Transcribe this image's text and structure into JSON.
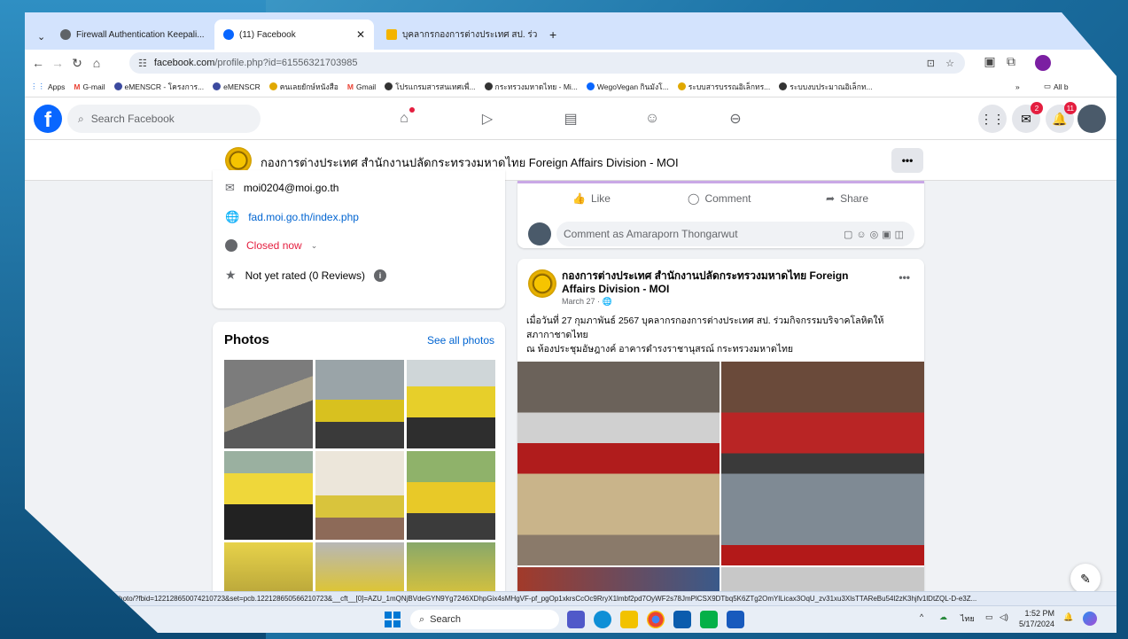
{
  "browser": {
    "tabs": [
      {
        "label": "Firewall Authentication Keepali...",
        "active": false,
        "favicon_color": "#5f6368"
      },
      {
        "label": "(11) Facebook",
        "active": true,
        "favicon_color": "#0866ff"
      },
      {
        "label": "บุคลากรกองการต่างประเทศ สป. ร่วม",
        "active": false,
        "favicon_color": "#f4b400"
      }
    ],
    "new_tab": "+",
    "url_host": "facebook.com",
    "url_path": "/profile.php?id=61556321703985",
    "bookmarks": [
      {
        "label": "Apps"
      },
      {
        "label": "G-mail"
      },
      {
        "label": "eMENSCR - โครงการ..."
      },
      {
        "label": "eMENSCR"
      },
      {
        "label": "คนเลยยักษ์หนังสือ"
      },
      {
        "label": "Gmail"
      },
      {
        "label": "โปรแกรมสารสนเทศเพื่..."
      },
      {
        "label": "กระทรวงมหาดไทย - Mi..."
      },
      {
        "label": "WegoVegan กินมังโ..."
      },
      {
        "label": "ระบบสารบรรณอิเล็กทร..."
      },
      {
        "label": "ระบบงบประมาณอิเล็กท..."
      }
    ],
    "bookmarks_more": "»",
    "all_bookmarks": "All b"
  },
  "facebook": {
    "search_placeholder": "Search Facebook",
    "messenger_badge": "2",
    "notifications_badge": "11",
    "page_title": "กองการต่างประเทศ สำนักงานปลัดกระทรวงมหาดไทย Foreign Affairs Division - MOI",
    "more_label": "•••",
    "intro": {
      "email": "moi0204@moi.go.th",
      "website": "fad.moi.go.th/index.php",
      "hours": "Closed now",
      "rating": "Not yet rated (0 Reviews)"
    },
    "photos": {
      "heading": "Photos",
      "see_all": "See all photos"
    },
    "post_actions": {
      "like": "Like",
      "comment": "Comment",
      "share": "Share",
      "comment_placeholder": "Comment as Amaraporn Thongarwut"
    },
    "post": {
      "author": "กองการต่างประเทศ สำนักงานปลัดกระทรวงมหาดไทย Foreign Affairs Division - MOI",
      "date": "March 27 ·",
      "text_line1": "เมื่อวันที่ 27 กุมภาพันธ์ 2567 บุคลากรกองการต่างประเทศ สป. ร่วมกิจกรรมบริจาคโลหิตให้",
      "text_line2": "สภากาชาดไทย",
      "text_line3": "ณ ห้องประชุมอัษฎางค์ อาคารดำรงราชานุสรณ์ กระทรวงมหาดไทย"
    }
  },
  "status_url": "...ok.com/photo/?fbid=122128650074210723&set=pcb.122128650566210723&__cft__[0]=AZU_1mQNjBVdeGYN9Yg7246XDhpGix4sMHgVF-pf_pgOp1xkrsCcOc9RryX1lmbf2pd7OyWF2s78JmPlCSX9DTbq5K6ZTg2OmYlLicax3OqU_zv31xu3XlsTTAReBu54l2zK3hjfv1lDtZQL-D-e3Z...",
  "taskbar": {
    "search": "Search",
    "lang": "ไทย",
    "time": "1:52 PM",
    "date": "5/17/2024"
  }
}
